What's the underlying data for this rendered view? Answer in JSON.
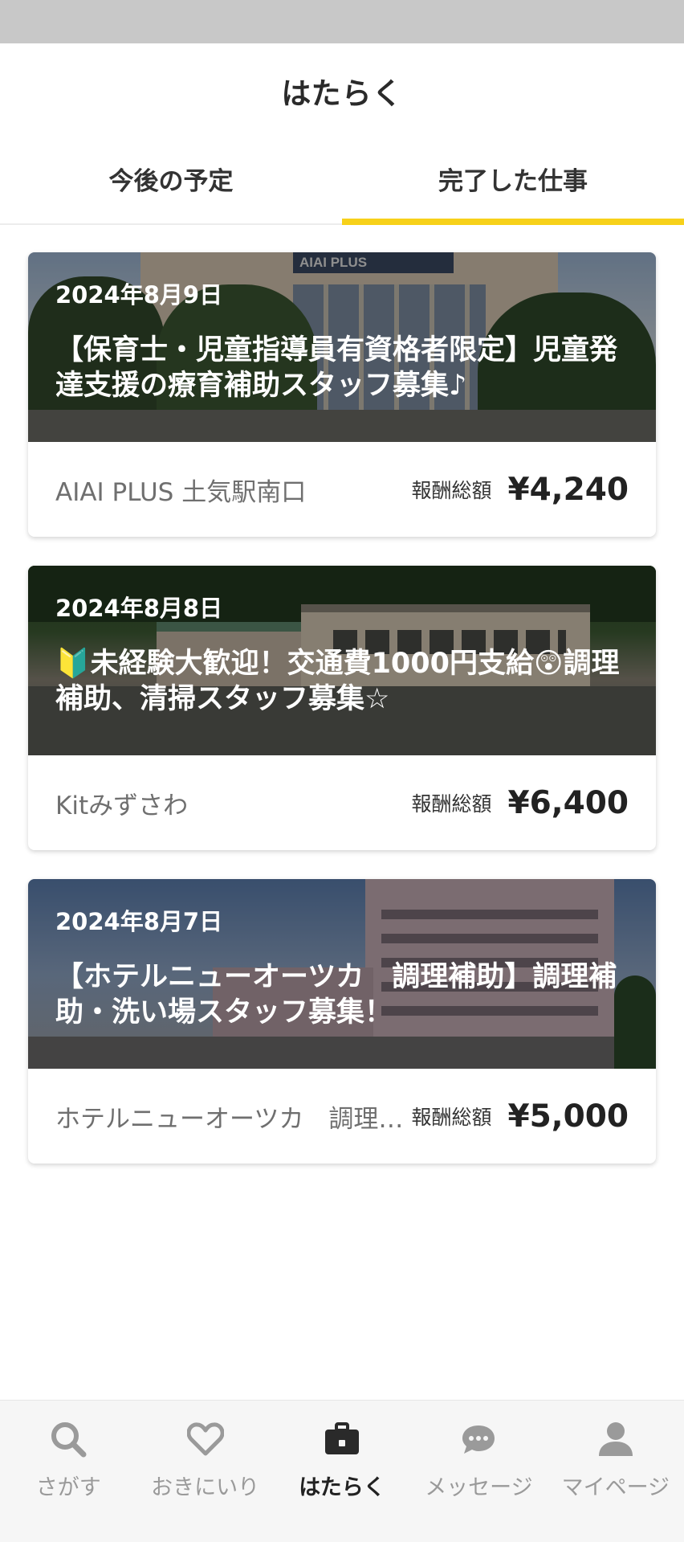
{
  "header": {
    "title": "はたらく"
  },
  "tabs": [
    {
      "label": "今後の予定",
      "active": false
    },
    {
      "label": "完了した仕事",
      "active": true
    }
  ],
  "jobs": [
    {
      "date": "2024年8月9日",
      "title": "【保育士・児童指導員有資格者限定】児童発達支援の療育補助スタッフ募集♪",
      "shop": "AIAI PLUS 土気駅南口",
      "pay_label": "報酬総額",
      "pay": "¥4,240",
      "sign_text": "AIAI PLUS"
    },
    {
      "date": "2024年8月8日",
      "title": "🔰未経験大歓迎！交通費1000円支給😲調理補助、清掃スタッフ募集☆",
      "shop": "Kitみずさわ",
      "pay_label": "報酬総額",
      "pay": "¥6,400"
    },
    {
      "date": "2024年8月7日",
      "title": "【ホテルニューオーツカ　調理補助】調理補助・洗い場スタッフ募集！",
      "shop": "ホテルニューオーツカ　調理補助",
      "pay_label": "報酬総額",
      "pay": "¥5,000"
    }
  ],
  "nav": [
    {
      "label": "さがす",
      "icon": "search-icon",
      "active": false
    },
    {
      "label": "おきにいり",
      "icon": "heart-icon",
      "active": false
    },
    {
      "label": "はたらく",
      "icon": "briefcase-icon",
      "active": true
    },
    {
      "label": "メッセージ",
      "icon": "message-icon",
      "active": false
    },
    {
      "label": "マイページ",
      "icon": "person-icon",
      "active": false
    }
  ],
  "colors": {
    "accent": "#f7d11a",
    "nav_inactive": "#9a9a9a",
    "nav_active": "#222222"
  }
}
